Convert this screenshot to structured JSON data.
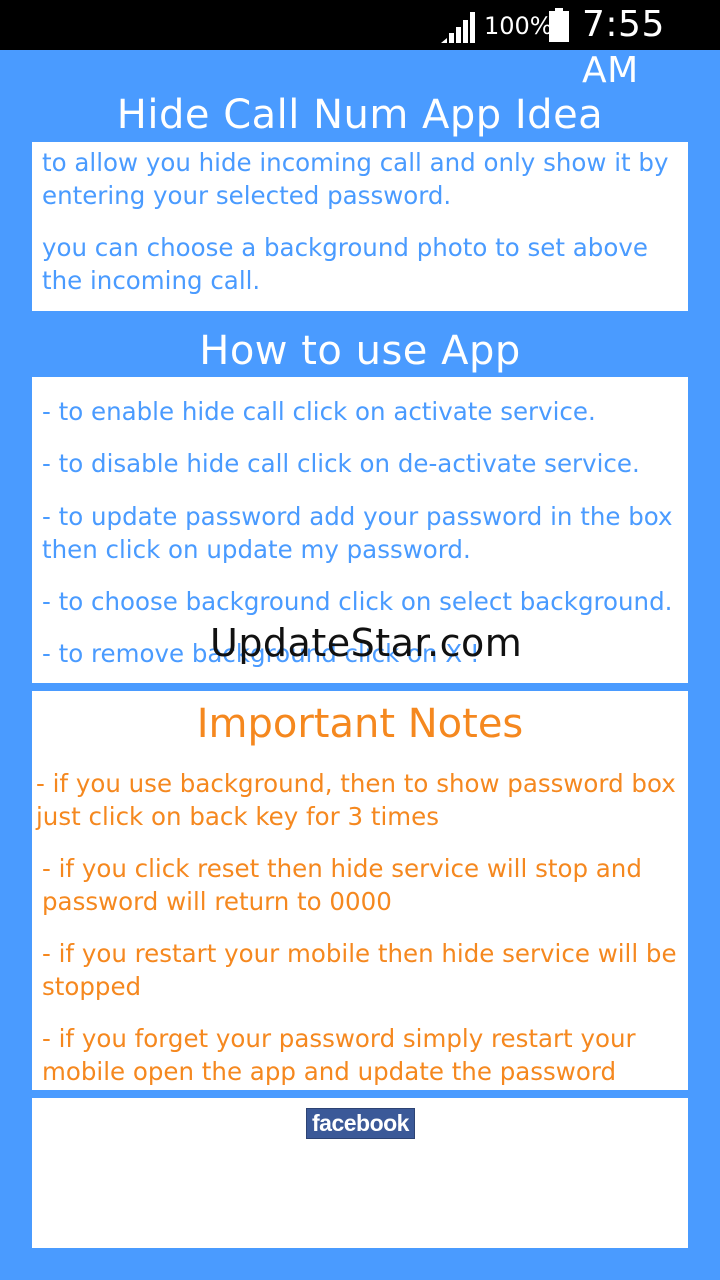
{
  "status_bar": {
    "battery_percent": "100%",
    "time": "7:55 AM"
  },
  "idea": {
    "title": "Hide Call Num App Idea",
    "paragraphs": [
      [
        "to allow you hide incoming call and only show it by",
        "entering your selected password."
      ],
      [
        "you can choose a background photo to set above",
        "the incoming call."
      ]
    ]
  },
  "how_to": {
    "title": "How to use App",
    "paragraphs": [
      [
        "- to enable hide call click on activate service."
      ],
      [
        "- to disable hide call click on de-activate service."
      ],
      [
        "- to update password add your password in the box",
        "then click on update my password."
      ],
      [
        "- to choose background click on select background."
      ],
      [
        "- to remove background click on X !"
      ]
    ]
  },
  "notes": {
    "title": "Important Notes",
    "paragraphs": [
      [
        "- if you use background, then to show password box",
        "just click on back key for 3 times"
      ],
      [
        "- if you click reset then hide service will stop and",
        "password will return to 0000"
      ],
      [
        "- if you restart your mobile then hide service will be",
        "stopped"
      ],
      [
        "- if you forget your password simply restart your",
        "mobile open the app and update the password"
      ]
    ]
  },
  "facebook": {
    "label": "facebook"
  },
  "watermark": "UpdateStar.com",
  "colors": {
    "background": "#4a9bff",
    "accent_blue": "#4a9bff",
    "accent_orange": "#f5881f",
    "facebook_blue": "#3b5998"
  }
}
